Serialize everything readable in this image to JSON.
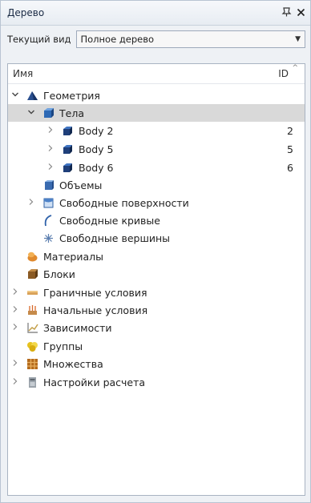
{
  "panel": {
    "title": "Дерево",
    "pin_glyph": "ð",
    "close_glyph": "×"
  },
  "view": {
    "label": "Текущий вид",
    "value": "Полное дерево"
  },
  "columns": {
    "name": "Имя",
    "id": "ID"
  },
  "tree": [
    {
      "label": "Геометрия",
      "expand": "expanded",
      "icon": "geometry-icon",
      "id": ""
    },
    {
      "label": "Тела",
      "expand": "expanded",
      "icon": "bodies-icon",
      "id": "",
      "selected": true
    },
    {
      "label": "Body 2",
      "expand": "collapsed",
      "icon": "body-icon",
      "id": "2"
    },
    {
      "label": "Body 5",
      "expand": "collapsed",
      "icon": "body-icon",
      "id": "5"
    },
    {
      "label": "Body 6",
      "expand": "collapsed",
      "icon": "body-icon",
      "id": "6"
    },
    {
      "label": "Объемы",
      "expand": "none",
      "icon": "volumes-icon",
      "id": ""
    },
    {
      "label": "Свободные поверхности",
      "expand": "collapsed",
      "icon": "surfaces-icon",
      "id": ""
    },
    {
      "label": "Свободные кривые",
      "expand": "none",
      "icon": "curves-icon",
      "id": ""
    },
    {
      "label": "Свободные вершины",
      "expand": "none",
      "icon": "vertices-icon",
      "id": ""
    },
    {
      "label": "Материалы",
      "expand": "none",
      "icon": "materials-icon",
      "id": ""
    },
    {
      "label": "Блоки",
      "expand": "none",
      "icon": "blocks-icon",
      "id": ""
    },
    {
      "label": "Граничные условия",
      "expand": "collapsed",
      "icon": "boundary-conditions-icon",
      "id": ""
    },
    {
      "label": "Начальные условия",
      "expand": "collapsed",
      "icon": "initial-conditions-icon",
      "id": ""
    },
    {
      "label": "Зависимости",
      "expand": "collapsed",
      "icon": "dependencies-icon",
      "id": ""
    },
    {
      "label": "Группы",
      "expand": "none",
      "icon": "groups-icon",
      "id": ""
    },
    {
      "label": "Множества",
      "expand": "collapsed",
      "icon": "sets-icon",
      "id": ""
    },
    {
      "label": "Настройки расчета",
      "expand": "collapsed",
      "icon": "calc-settings-icon",
      "id": ""
    }
  ]
}
